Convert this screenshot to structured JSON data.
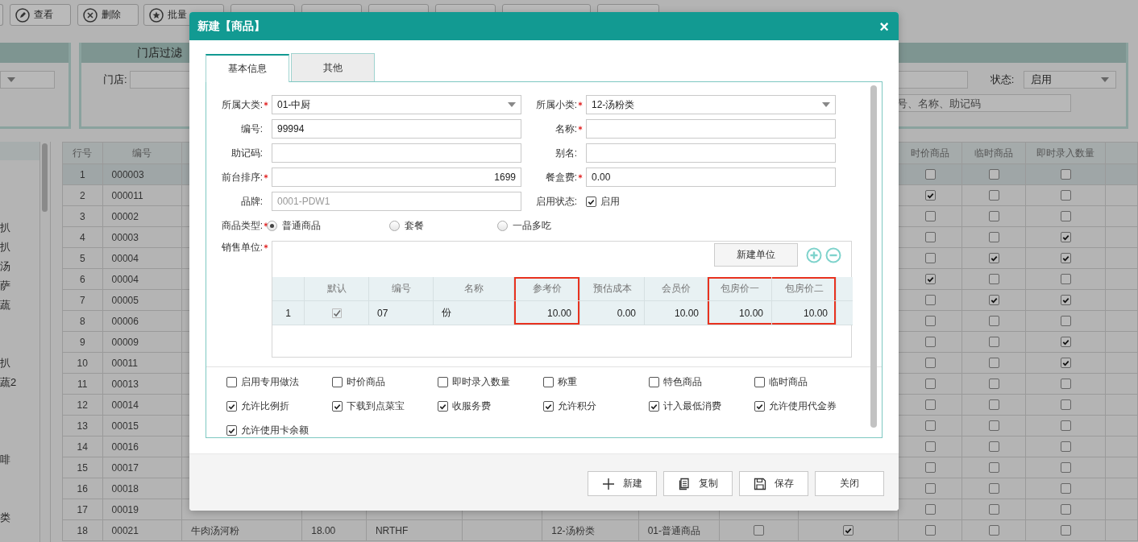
{
  "toolbar": [
    {
      "label": "查看"
    },
    {
      "label": "删除"
    },
    {
      "label": "批量"
    }
  ],
  "store_filter": {
    "title": "门店过滤",
    "store_label": "门店:",
    "status_label": "状态:",
    "status_value": "启用",
    "search_placeholder": "号、名称、助记码"
  },
  "category_list": {
    "items": [
      "扒",
      "扒",
      "汤",
      "萨",
      "蔬",
      "扒",
      "蔬2",
      "啡",
      "类"
    ]
  },
  "table": {
    "headers": {
      "column_1": "行号",
      "column_2": "编号",
      "column_11": "时价商品",
      "column_12": "临时商品",
      "column_13": "即时录入数量"
    },
    "rows": [
      {
        "selected": true,
        "column_1": "1",
        "column_2": "000003",
        "column_11": false,
        "column_12": false,
        "column_13": false
      },
      {
        "selected": false,
        "column_1": "2",
        "column_2": "000011",
        "column_11": true,
        "column_12": false,
        "column_13": false
      },
      {
        "selected": false,
        "column_1": "3",
        "column_2": "00002",
        "column_11": false,
        "column_12": false,
        "column_13": false
      },
      {
        "selected": false,
        "column_1": "4",
        "column_2": "00003",
        "column_11": false,
        "column_12": false,
        "column_13": true
      },
      {
        "selected": false,
        "column_1": "5",
        "column_2": "00004",
        "column_11": false,
        "column_12": true,
        "column_13": true
      },
      {
        "selected": false,
        "column_1": "6",
        "column_2": "00004",
        "column_11": true,
        "column_12": false,
        "column_13": false
      },
      {
        "selected": false,
        "column_1": "7",
        "column_2": "00005",
        "column_11": false,
        "column_12": true,
        "column_13": true
      },
      {
        "selected": false,
        "column_1": "8",
        "column_2": "00006",
        "column_11": false,
        "column_12": false,
        "column_13": false
      },
      {
        "selected": false,
        "column_1": "9",
        "column_2": "00009",
        "column_11": false,
        "column_12": false,
        "column_13": true
      },
      {
        "selected": false,
        "column_1": "10",
        "column_2": "00011",
        "column_11": false,
        "column_12": false,
        "column_13": true
      },
      {
        "selected": false,
        "column_1": "11",
        "column_2": "00013",
        "column_11": false,
        "column_12": false,
        "column_13": false
      },
      {
        "selected": false,
        "column_1": "12",
        "column_2": "00014",
        "column_11": false,
        "column_12": false,
        "column_13": false
      },
      {
        "selected": false,
        "column_1": "13",
        "column_2": "00015",
        "column_11": false,
        "column_12": false,
        "column_13": false
      },
      {
        "selected": false,
        "column_1": "14",
        "column_2": "00016",
        "column_11": false,
        "column_12": false,
        "column_13": false
      },
      {
        "selected": false,
        "column_1": "15",
        "column_2": "00017",
        "column_11": false,
        "column_12": false,
        "column_13": false
      },
      {
        "selected": false,
        "column_1": "16",
        "column_2": "00018",
        "column_11": false,
        "column_12": false,
        "column_13": false
      },
      {
        "selected": false,
        "column_1": "17",
        "column_2": "00019",
        "column_11": false,
        "column_12": false,
        "column_13": false
      },
      {
        "selected": false,
        "column_1": "18",
        "column_2": "00021",
        "column_3": "牛肉汤河粉",
        "column_4": "18.00",
        "column_5": "NRTHF",
        "column_7": "12-汤粉类",
        "column_8": "01-普通商品",
        "column_9": false,
        "column_10": true,
        "column_11": false,
        "column_12": false,
        "column_13": false
      }
    ]
  },
  "dialog": {
    "title": "新建【商品】",
    "close": "×",
    "tabs": [
      {
        "label": "基本信息",
        "selected": true
      },
      {
        "label": "其他",
        "selected": false
      }
    ],
    "fields": [
      {
        "label": "所属大类:",
        "required": true,
        "kind": "select",
        "value": "01-中厨"
      },
      {
        "label": "所属小类:",
        "required": true,
        "kind": "select",
        "value": "12-汤粉类"
      },
      {
        "label": "编号:",
        "required": false,
        "kind": "input",
        "value": "99994"
      },
      {
        "label": "名称:",
        "required": true,
        "kind": "input"
      },
      {
        "label": "助记码:",
        "required": false,
        "kind": "input"
      },
      {
        "label": "别名:",
        "required": false,
        "kind": "input"
      },
      {
        "label": "前台排序:",
        "required": true,
        "kind": "number",
        "value": "1699"
      },
      {
        "label": "餐盒费:",
        "required": true,
        "kind": "input",
        "value": "0.00"
      },
      {
        "label": "品牌:",
        "required": false,
        "kind": "input",
        "value": "0001-PDW1",
        "disabled": true
      },
      {
        "label": "启用状态:",
        "required": false,
        "kind": "checkbox",
        "text": "启用",
        "checked": true
      }
    ],
    "product_type": {
      "label": "商品类型:",
      "required": true,
      "options": [
        {
          "label": "普通商品",
          "selected": true
        },
        {
          "label": "套餐",
          "selected": false
        },
        {
          "label": "一品多吃",
          "selected": false
        }
      ]
    },
    "sales_unit": {
      "label": "销售单位:",
      "required": true,
      "new_button": "新建单位",
      "columns": [
        {
          "highlighted": false
        },
        {
          "label": "默认",
          "highlighted": false
        },
        {
          "label": "编号",
          "highlighted": false
        },
        {
          "label": "名称",
          "highlighted": false
        },
        {
          "label": "参考价",
          "highlighted": true
        },
        {
          "label": "预估成本",
          "highlighted": false
        },
        {
          "label": "会员价",
          "highlighted": false
        },
        {
          "label": "包房价一",
          "highlighted": true
        },
        {
          "label": "包房价二",
          "highlighted": true
        }
      ],
      "rows": [
        {
          "index": "1",
          "default": true,
          "values": [
            "07",
            "份",
            "10.00",
            "0.00",
            "10.00",
            "10.00",
            "10.00"
          ]
        }
      ]
    },
    "options": [
      {
        "label": "启用专用做法",
        "checked": false
      },
      {
        "label": "时价商品",
        "checked": false
      },
      {
        "label": "即时录入数量",
        "checked": false
      },
      {
        "label": "称重",
        "checked": false
      },
      {
        "label": "特色商品",
        "checked": false
      },
      {
        "label": "临时商品",
        "checked": false
      },
      {
        "label": "允许比例折",
        "checked": true
      },
      {
        "label": "下载到点菜宝",
        "checked": true
      },
      {
        "label": "收服务费",
        "checked": true
      },
      {
        "label": "允许积分",
        "checked": true
      },
      {
        "label": "计入最低消费",
        "checked": true
      },
      {
        "label": "允许使用代金券",
        "checked": true
      },
      {
        "label": "允许使用卡余额",
        "checked": true
      }
    ],
    "buttons": [
      {
        "label": "新建"
      },
      {
        "label": "复制"
      },
      {
        "label": "保存"
      },
      {
        "label": "关闭"
      }
    ]
  }
}
